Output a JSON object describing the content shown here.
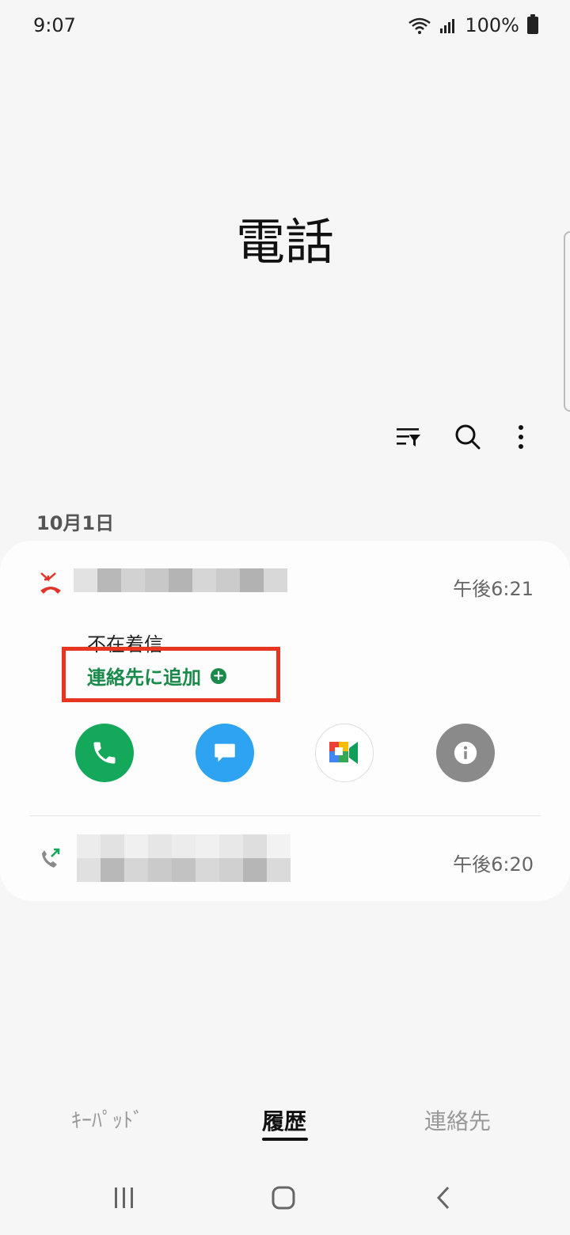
{
  "status_bar": {
    "time": "9:07",
    "battery": "100%"
  },
  "app": {
    "title": "電話"
  },
  "call_log": {
    "date_header": "10月1日",
    "entries": [
      {
        "type": "missed",
        "time": "午後6:21",
        "status": "不在着信",
        "add_contact": "連絡先に追加"
      },
      {
        "type": "outgoing",
        "time": "午後6:20"
      }
    ]
  },
  "actions": {
    "icons": [
      "phone-icon",
      "message-icon",
      "video-call-icon",
      "info-icon"
    ]
  },
  "tabs": [
    {
      "label": "ｷｰﾊﾟｯﾄﾞ"
    },
    {
      "label": "履歴",
      "selected": true
    },
    {
      "label": "連絡先"
    }
  ],
  "colors": {
    "missed": "#e0342b",
    "accent_green": "#1a8a4a",
    "call_green": "#14a85b",
    "message_blue": "#2ea3f2",
    "highlight": "#e8351f"
  }
}
